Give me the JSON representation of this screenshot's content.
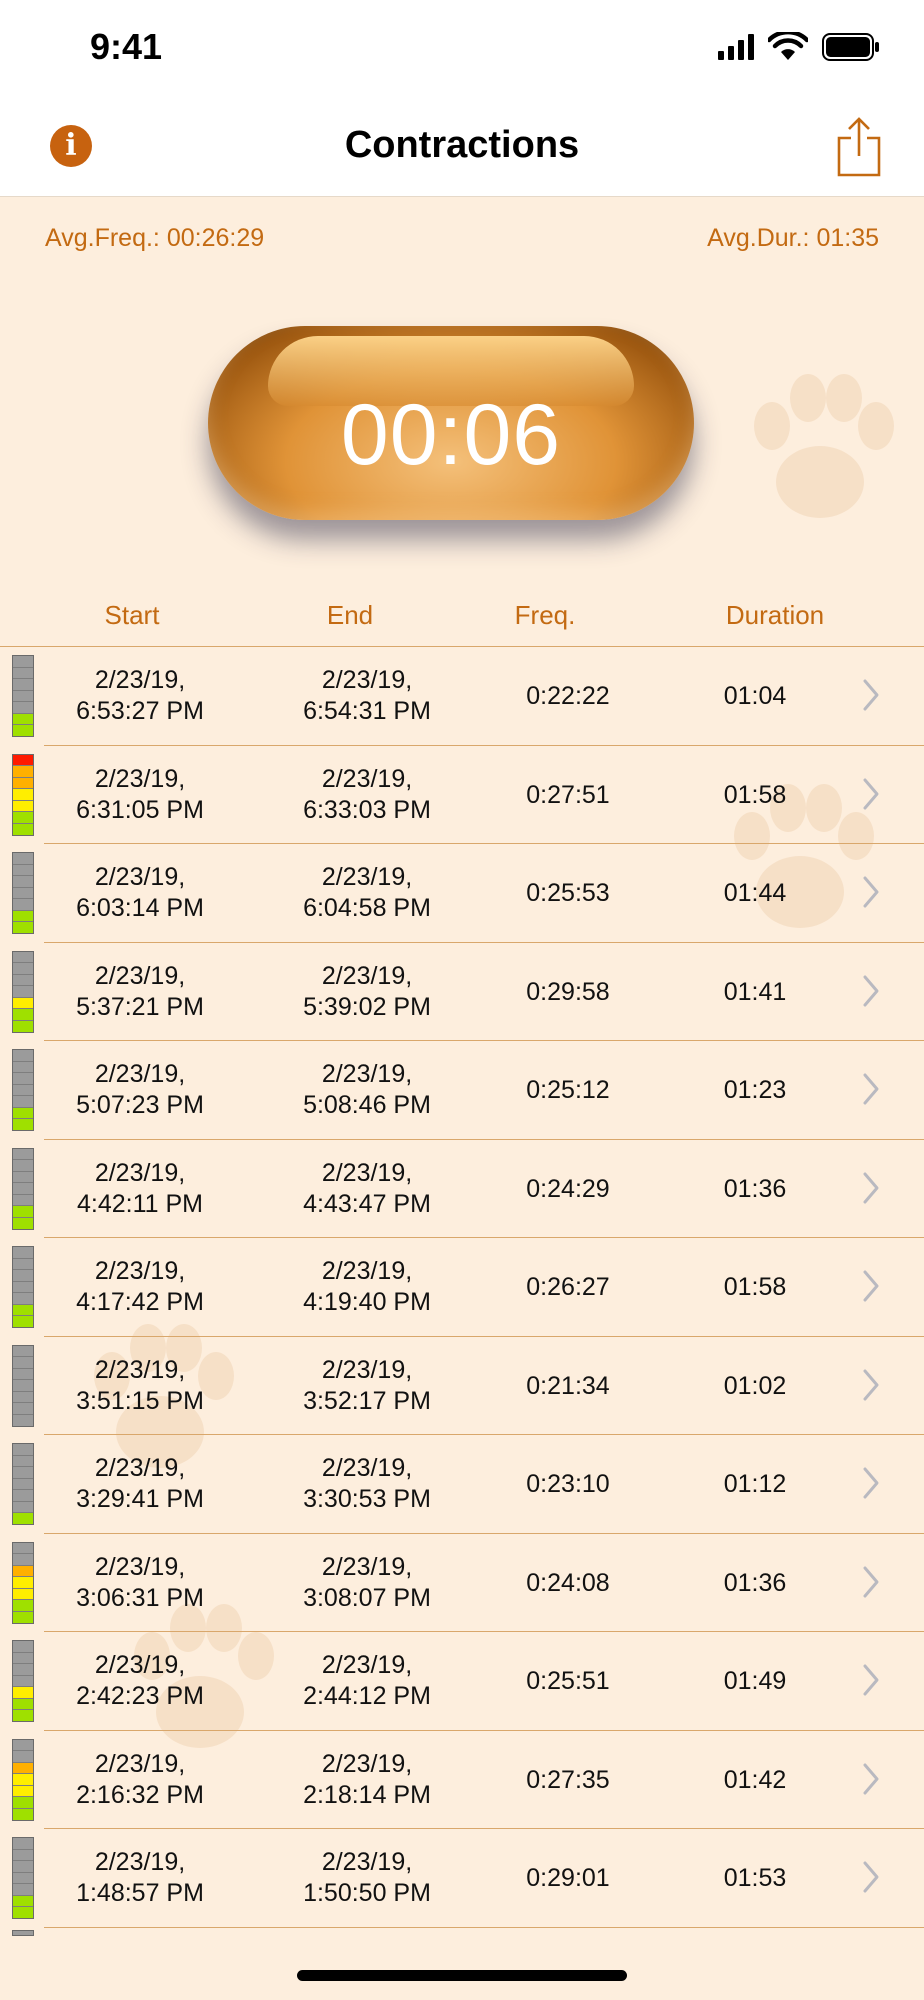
{
  "status": {
    "time": "9:41"
  },
  "nav": {
    "title": "Contractions",
    "info_icon": "info-icon",
    "share_icon": "share-icon"
  },
  "summary": {
    "avg_freq": "Avg.Freq.: 00:26:29",
    "avg_dur": "Avg.Dur.: 01:35"
  },
  "timer": {
    "value": "00:06"
  },
  "table": {
    "headers": {
      "start": "Start",
      "end": "End",
      "freq": "Freq.",
      "duration": "Duration"
    },
    "rows": [
      {
        "start": [
          "2/23/19,",
          "6:53:27 PM"
        ],
        "end": [
          "2/23/19,",
          "6:54:31 PM"
        ],
        "freq": "0:22:22",
        "duration": "01:04",
        "level": 2
      },
      {
        "start": [
          "2/23/19,",
          "6:31:05 PM"
        ],
        "end": [
          "2/23/19,",
          "6:33:03 PM"
        ],
        "freq": "0:27:51",
        "duration": "01:58",
        "level": 7
      },
      {
        "start": [
          "2/23/19,",
          "6:03:14 PM"
        ],
        "end": [
          "2/23/19,",
          "6:04:58 PM"
        ],
        "freq": "0:25:53",
        "duration": "01:44",
        "level": 2
      },
      {
        "start": [
          "2/23/19,",
          "5:37:21 PM"
        ],
        "end": [
          "2/23/19,",
          "5:39:02 PM"
        ],
        "freq": "0:29:58",
        "duration": "01:41",
        "level": 3
      },
      {
        "start": [
          "2/23/19,",
          "5:07:23 PM"
        ],
        "end": [
          "2/23/19,",
          "5:08:46 PM"
        ],
        "freq": "0:25:12",
        "duration": "01:23",
        "level": 2
      },
      {
        "start": [
          "2/23/19,",
          "4:42:11 PM"
        ],
        "end": [
          "2/23/19,",
          "4:43:47 PM"
        ],
        "freq": "0:24:29",
        "duration": "01:36",
        "level": 2
      },
      {
        "start": [
          "2/23/19,",
          "4:17:42 PM"
        ],
        "end": [
          "2/23/19,",
          "4:19:40 PM"
        ],
        "freq": "0:26:27",
        "duration": "01:58",
        "level": 2
      },
      {
        "start": [
          "2/23/19,",
          "3:51:15 PM"
        ],
        "end": [
          "2/23/19,",
          "3:52:17 PM"
        ],
        "freq": "0:21:34",
        "duration": "01:02",
        "level": 0
      },
      {
        "start": [
          "2/23/19,",
          "3:29:41 PM"
        ],
        "end": [
          "2/23/19,",
          "3:30:53 PM"
        ],
        "freq": "0:23:10",
        "duration": "01:12",
        "level": 1
      },
      {
        "start": [
          "2/23/19,",
          "3:06:31 PM"
        ],
        "end": [
          "2/23/19,",
          "3:08:07 PM"
        ],
        "freq": "0:24:08",
        "duration": "01:36",
        "level": 5
      },
      {
        "start": [
          "2/23/19,",
          "2:42:23 PM"
        ],
        "end": [
          "2/23/19,",
          "2:44:12 PM"
        ],
        "freq": "0:25:51",
        "duration": "01:49",
        "level": 3
      },
      {
        "start": [
          "2/23/19,",
          "2:16:32 PM"
        ],
        "end": [
          "2/23/19,",
          "2:18:14 PM"
        ],
        "freq": "0:27:35",
        "duration": "01:42",
        "level": 5
      },
      {
        "start": [
          "2/23/19,",
          "1:48:57 PM"
        ],
        "end": [
          "2/23/19,",
          "1:50:50 PM"
        ],
        "freq": "0:29:01",
        "duration": "01:53",
        "level": 2
      }
    ]
  },
  "colors": {
    "accent": "#c36a12",
    "background": "#fdeedd",
    "divider": "#d9a76b",
    "meter_levels": [
      "#9fe000",
      "#9fe000",
      "#ffee00",
      "#ffee00",
      "#ffb000",
      "#ffb000",
      "#ff1a00"
    ]
  }
}
